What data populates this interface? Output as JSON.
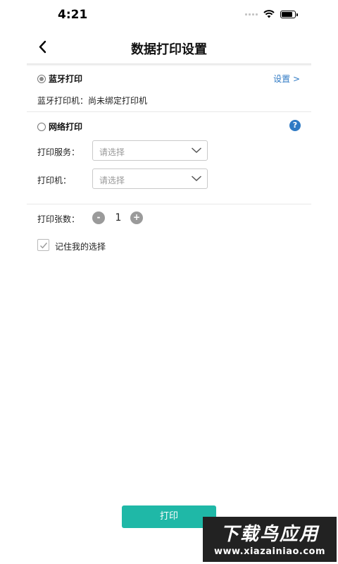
{
  "status_bar": {
    "time": "4:21"
  },
  "nav": {
    "title": "数据打印设置"
  },
  "bluetooth": {
    "label": "蓝牙打印",
    "selected": true,
    "settings_link": "设置 >",
    "printer_line": "蓝牙打印机：尚未绑定打印机"
  },
  "network": {
    "label": "网络打印",
    "selected": false,
    "help_glyph": "?",
    "service_label": "打印服务：",
    "service_placeholder": "请选择",
    "printer_label": "打印机：",
    "printer_placeholder": "请选择"
  },
  "copies": {
    "label": "打印张数：",
    "minus": "-",
    "value": "1",
    "plus": "+"
  },
  "remember": {
    "label": "记住我的选择",
    "checked": true
  },
  "print_button": {
    "label": "打印"
  },
  "watermark": {
    "title": "下载鸟应用",
    "url": "www.xiazainiao.com"
  },
  "colors": {
    "accent": "#1fb8a7",
    "link": "#2f7ac4"
  }
}
